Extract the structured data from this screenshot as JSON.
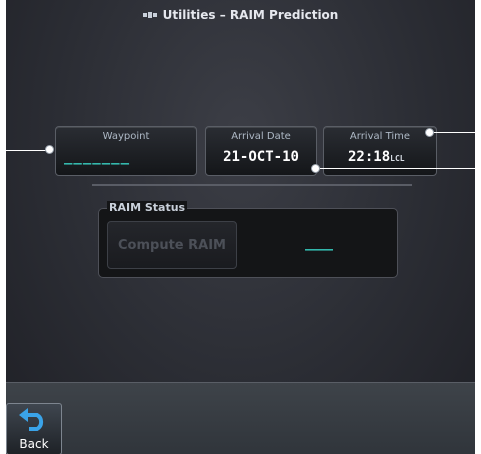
{
  "title": {
    "text": "Utilities – RAIM Prediction",
    "icon": "satellite-icon"
  },
  "waypoint": {
    "label": "Waypoint",
    "value": "_______"
  },
  "arrival_date": {
    "label": "Arrival Date",
    "value": "21-OCT-10"
  },
  "arrival_time": {
    "label": "Arrival Time",
    "value": "22:18",
    "unit": "LCL"
  },
  "raim": {
    "title": "RAIM Status",
    "compute_label": "Compute RAIM",
    "status_value": "____"
  },
  "back": {
    "label": "Back",
    "icon": "back-arrow-icon"
  },
  "colors": {
    "cyan_value": "#39d6c8",
    "background": "#2b2d34"
  }
}
